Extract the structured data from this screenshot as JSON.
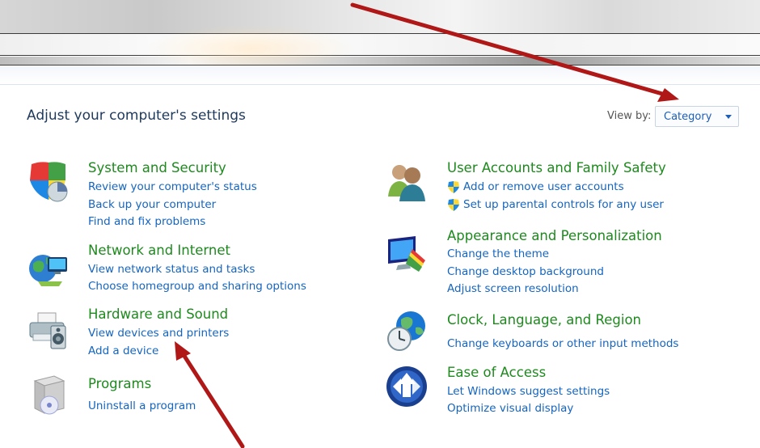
{
  "header": {
    "title": "Adjust your computer's settings",
    "view_by_label": "View by:",
    "view_by_value": "Category"
  },
  "categories": [
    {
      "title": "System and Security",
      "links": [
        "Review your computer's status",
        "Back up your computer",
        "Find and fix problems"
      ],
      "icon": "shield-pie-icon"
    },
    {
      "title": "Network and Internet",
      "links": [
        "View network status and tasks",
        "Choose homegroup and sharing options"
      ],
      "icon": "network-globe-icon"
    },
    {
      "title": "Hardware and Sound",
      "links": [
        "View devices and printers",
        "Add a device"
      ],
      "icon": "printer-speaker-icon"
    },
    {
      "title": "Programs",
      "links": [
        "Uninstall a program"
      ],
      "icon": "programs-box-icon"
    },
    {
      "title": "User Accounts and Family Safety",
      "links": [
        "Add or remove user accounts",
        "Set up parental controls for any user"
      ],
      "icon": "users-icon"
    },
    {
      "title": "Appearance and Personalization",
      "links": [
        "Change the theme",
        "Change desktop background",
        "Adjust screen resolution"
      ],
      "icon": "monitor-palette-icon"
    },
    {
      "title": "Clock, Language, and Region",
      "links": [
        "Change keyboards or other input methods"
      ],
      "icon": "clock-globe-icon"
    },
    {
      "title": "Ease of Access",
      "links": [
        "Let Windows suggest settings",
        "Optimize visual display"
      ],
      "icon": "ease-of-access-icon"
    }
  ],
  "colors": {
    "category_title": "#1e8a1e",
    "link": "#1565c0",
    "page_title": "#1e395b",
    "annotation_arrow": "#b01818"
  }
}
